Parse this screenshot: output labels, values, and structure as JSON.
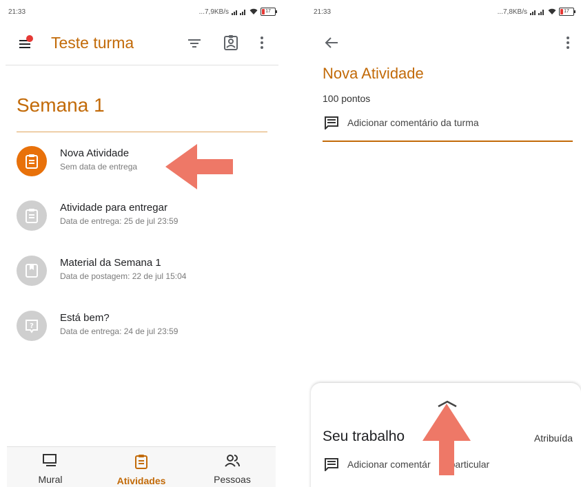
{
  "left": {
    "status": {
      "time": "21:33",
      "speed": "...7,9KB/s",
      "battery": "17"
    },
    "header": {
      "title": "Teste turma"
    },
    "topic": {
      "title": "Semana 1"
    },
    "items": [
      {
        "title": "Nova Atividade",
        "subtitle": "Sem data de entrega",
        "icon": "assignment-icon",
        "color": "#e8710a"
      },
      {
        "title": "Atividade para entregar",
        "subtitle": "Data de entrega: 25 de jul 23:59",
        "icon": "assignment-icon",
        "color": "#bdbdbd"
      },
      {
        "title": "Material da Semana 1",
        "subtitle": "Data de postagem: 22 de jul 15:04",
        "icon": "material-icon",
        "color": "#bdbdbd"
      },
      {
        "title": "Está bem?",
        "subtitle": "Data de entrega: 24 de jul 23:59",
        "icon": "question-icon",
        "color": "#bdbdbd"
      }
    ],
    "nav": [
      {
        "label": "Mural",
        "icon": "stream-icon"
      },
      {
        "label": "Atividades",
        "icon": "classwork-icon",
        "active": true
      },
      {
        "label": "Pessoas",
        "icon": "people-icon"
      }
    ]
  },
  "right": {
    "status": {
      "time": "21:33",
      "speed": "...7,8KB/s",
      "battery": "17"
    },
    "title": "Nova Atividade",
    "points": "100 pontos",
    "class_comment": "Adicionar comentário da turma",
    "sheet": {
      "title": "Seu trabalho",
      "status": "Atribuída",
      "private_comment_before": "Adicionar comentár",
      "private_comment_after": "particular"
    }
  },
  "colors": {
    "accent": "#c26a08",
    "active_icon": "#e8710a",
    "arrow": "#ee7867",
    "inactive_icon": "#bdbdbd"
  }
}
